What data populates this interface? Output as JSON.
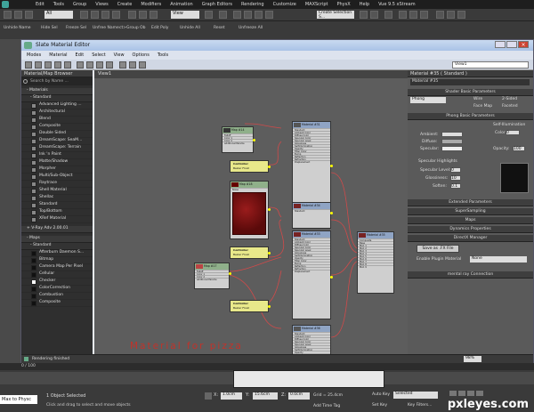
{
  "app": {
    "title": "Vue 9.5 xStream",
    "menu": [
      "Edit",
      "Tools",
      "Group",
      "Views",
      "Create",
      "Modifiers",
      "Animation",
      "Graph Editors",
      "Rendering",
      "Customize",
      "MAXScript",
      "PhysX",
      "Help"
    ],
    "filter_all": "All",
    "view_select": "View",
    "selection_set": "Create Selection S..."
  },
  "toolbar2": [
    "Unhide Name",
    "Hide Sel",
    "Freeze Sel",
    "Unfree Name",
    "ct>Group Ob",
    "Edit Poly",
    "Unhide All",
    "Reset",
    "Unfreeze All"
  ],
  "editor": {
    "title": "Slate Material Editor",
    "menu": [
      "Modes",
      "Material",
      "Edit",
      "Select",
      "View",
      "Options",
      "Tools"
    ],
    "view_dropdown": "View1",
    "view_tab": "View1",
    "browser_title": "Material/Map Browser",
    "search_placeholder": "Search by Name ...",
    "materials_header": "- Materials",
    "standard_header": "- Standard",
    "materials": [
      "Advanced Lighting ...",
      "Architectural",
      "Blend",
      "Composite",
      "Double Sided",
      "DreamScape: SeaM...",
      "DreamScape: Terrain",
      "Ink 'n Paint",
      "Matte/Shadow",
      "Morpher",
      "Multi/Sub-Object",
      "Raytrace",
      "Shell Material",
      "Shellac",
      "Standard",
      "Top/Bottom",
      "XRef Material"
    ],
    "vray_header": "+ V-Ray Adv 2.00.01",
    "maps_header": "- Maps",
    "maps_standard": "- Standard",
    "maps": [
      "Afterburn Daemon S...",
      "Bitmap",
      "Camera Map Per Pixel",
      "Cellular",
      "Checker",
      "ColorCorrection",
      "Combustion",
      "Composite"
    ],
    "status_text": "Rendering finished",
    "zoom": "98%"
  },
  "nodes": {
    "map1_title": "Map #14",
    "map1_sub": "Falloff",
    "mat1_title": "Material #31",
    "mat1_sub": "Standard",
    "ctrl1": "Controller",
    "ctrl1_sub": "Bezier Float",
    "map2_title": "Map #18",
    "map2_sub": "Noise",
    "ctrl2": "Controller",
    "ctrl2_sub": "Bezier Float",
    "map3_title": "Map #17",
    "map3_sub": "Falloff",
    "mat2_title": "Material #34",
    "mat2_sub": "Standard",
    "ctrl3": "Controller",
    "ctrl3_sub": "Bezier Float",
    "mat3_title": "Material #35",
    "mat3_sub": "Composite",
    "mat4_title": "Material #33",
    "mat4_sub": "Standard",
    "mat5_title": "Material #36",
    "mat5_sub": "Standard",
    "rows_std": [
      "Ambient Color",
      "Diffuse Color",
      "Specular Color",
      "Specular Level",
      "Glossiness",
      "Self-Illumination",
      "Opacity",
      "Filter Color",
      "Bump",
      "Reflection",
      "Refraction",
      "Displacement"
    ],
    "rows_comp": [
      "Base",
      "Mat. 1",
      "Mat. 2",
      "Mat. 3",
      "Mat. 4",
      "Mat. 5",
      "Mat. 6",
      "Mat. 7",
      "Mat. 8",
      "Mat. 9"
    ],
    "rows_map": [
      "Color 1",
      "Color 2",
      "Additional Params"
    ]
  },
  "overlay_text": "Material for pizza",
  "props": {
    "header": "Material #35 ( Standard )",
    "name": "Material #35",
    "shader_title": "Shader Basic Parameters",
    "shader": "Phong",
    "wire": "Wire",
    "two_sided": "2-Sided",
    "face_map": "Face Map",
    "faceted": "Faceted",
    "phong_title": "Phong Basic Parameters",
    "self_illum": "Self-Illumination",
    "color_label": "Color",
    "color_val": "0",
    "ambient": "Ambient:",
    "diffuse": "Diffuse:",
    "specular": "Specular:",
    "opacity": "Opacity:",
    "opacity_val": "100",
    "highlights": "Specular Highlights",
    "spec_level": "Specular Level:",
    "spec_level_val": "0",
    "gloss": "Glossiness:",
    "gloss_val": "10",
    "soften": "Soften:",
    "soften_val": "0.1",
    "rollouts": [
      "Extended Parameters",
      "SuperSampling",
      "Maps",
      "Dynamics Properties",
      "DirectX Manager"
    ],
    "save_fx": "Save as .FX File",
    "enable_plugin": "Enable Plugin Material",
    "none": "None",
    "mental_ray": "mental ray Connection"
  },
  "statusbar": {
    "time": "0 / 100",
    "selected": "1 Object Selected",
    "hint": "Click and drag to select and move objects",
    "x": "1.0cm",
    "y": "15.6cm",
    "z": "0.0cm",
    "grid": "Grid = 25.4cm",
    "auto_key": "Auto Key",
    "selected_dd": "Selected",
    "set_key": "Set Key",
    "key_filters": "Key Filters...",
    "add_time_tag": "Add Time Tag",
    "maxscript": "Max to Physc"
  },
  "watermark": "pxleyes.com",
  "colors": {
    "accent": "#c0332b",
    "node_bg": "#cfcfcf",
    "bezier": "#e8e88a"
  }
}
